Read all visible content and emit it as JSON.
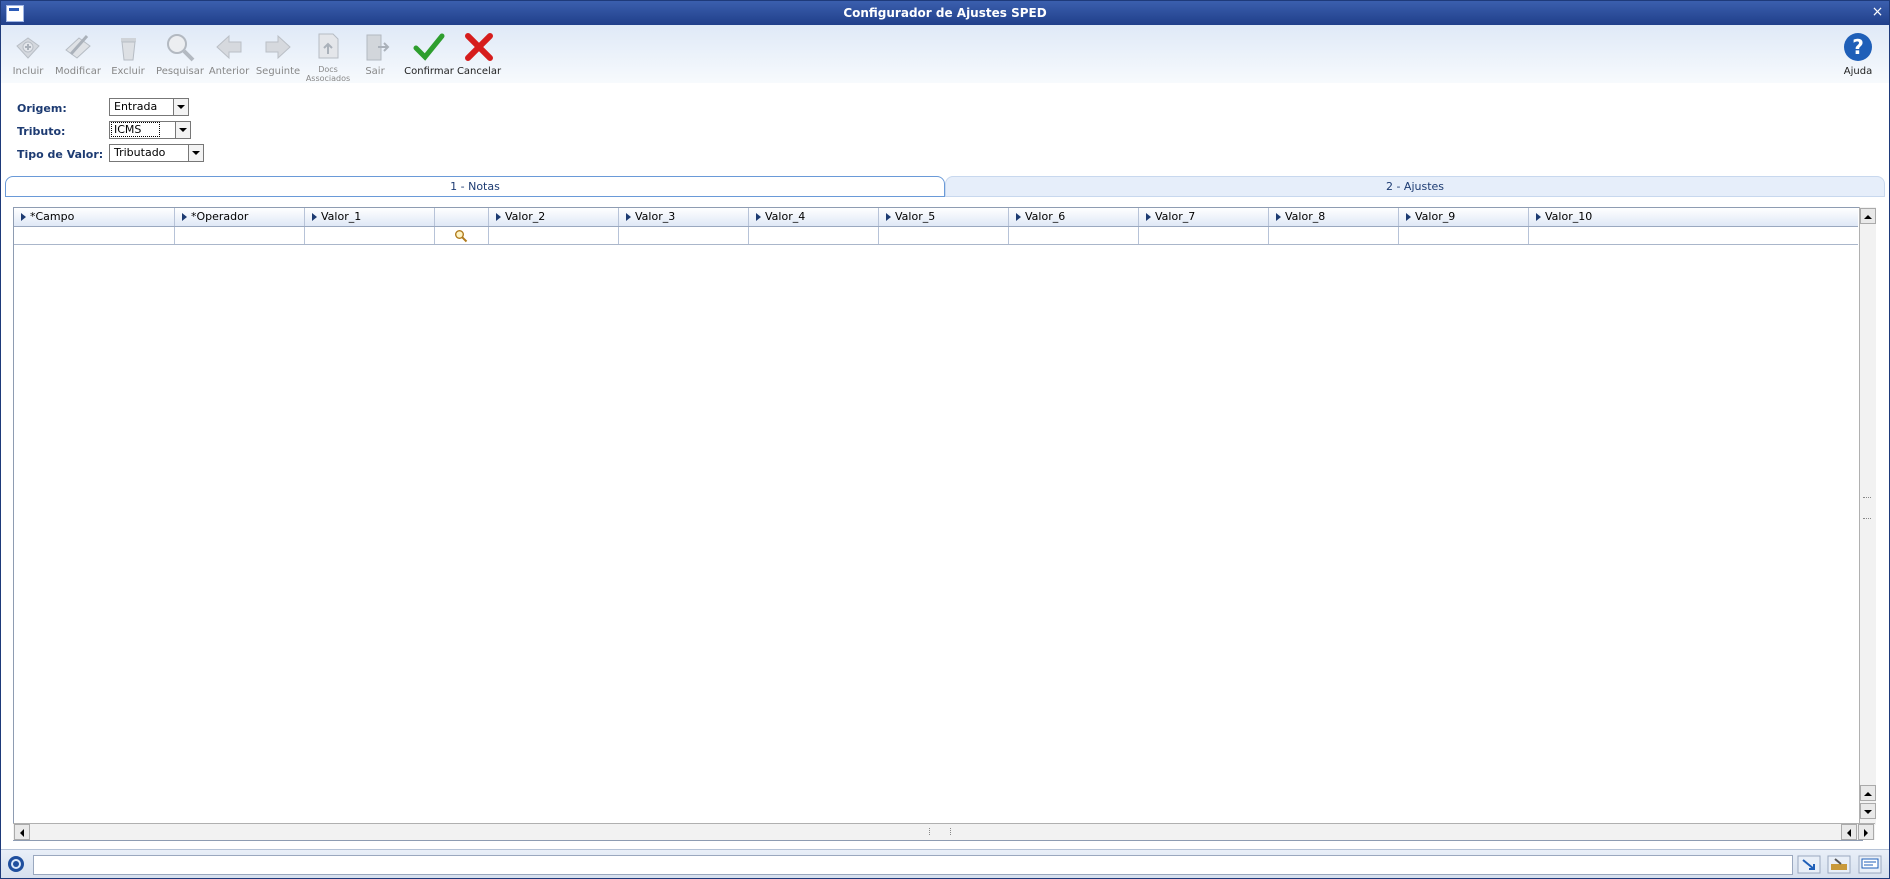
{
  "window": {
    "title": "Configurador de Ajustes SPED"
  },
  "toolbar": {
    "buttons": [
      {
        "label": "Incluir",
        "icon": "add-doc-icon",
        "enabled": false
      },
      {
        "label": "Modificar",
        "icon": "edit-doc-icon",
        "enabled": false
      },
      {
        "label": "Excluir",
        "icon": "trash-icon",
        "enabled": false
      },
      {
        "label": "Pesquisar",
        "icon": "search-icon",
        "enabled": false
      },
      {
        "label": "Anterior",
        "icon": "arrow-left-icon",
        "enabled": false
      },
      {
        "label": "Seguinte",
        "icon": "arrow-right-icon",
        "enabled": false
      },
      {
        "label": "Docs Associados",
        "icon": "associated-docs-icon",
        "enabled": false
      },
      {
        "label": "Sair",
        "icon": "exit-door-icon",
        "enabled": false
      },
      {
        "label": "Confirmar",
        "icon": "checkmark-icon",
        "enabled": true
      },
      {
        "label": "Cancelar",
        "icon": "cancel-x-icon",
        "enabled": true
      }
    ],
    "help": {
      "label": "Ajuda",
      "icon": "help-icon"
    }
  },
  "form": {
    "origem": {
      "label": "Origem:",
      "value": "Entrada"
    },
    "tributo": {
      "label": "Tributo:",
      "value": "ICMS"
    },
    "tipo_valor": {
      "label": "Tipo de Valor:",
      "value": "Tributado"
    }
  },
  "tabs": [
    {
      "label": "1 - Notas",
      "active": true
    },
    {
      "label": "2 - Ajustes",
      "active": false
    }
  ],
  "grid": {
    "columns": [
      "*Campo",
      "*Operador",
      "Valor_1",
      "",
      "Valor_2",
      "Valor_3",
      "Valor_4",
      "Valor_5",
      "Valor_6",
      "Valor_7",
      "Valor_8",
      "Valor_9",
      "Valor_10"
    ]
  },
  "status": {
    "text": ""
  },
  "colors": {
    "title_bar": "#2a4c9c",
    "accent": "#1d3b72",
    "confirm": "#2e9e2e",
    "cancel": "#d61c1c",
    "help": "#1f5fb8"
  }
}
